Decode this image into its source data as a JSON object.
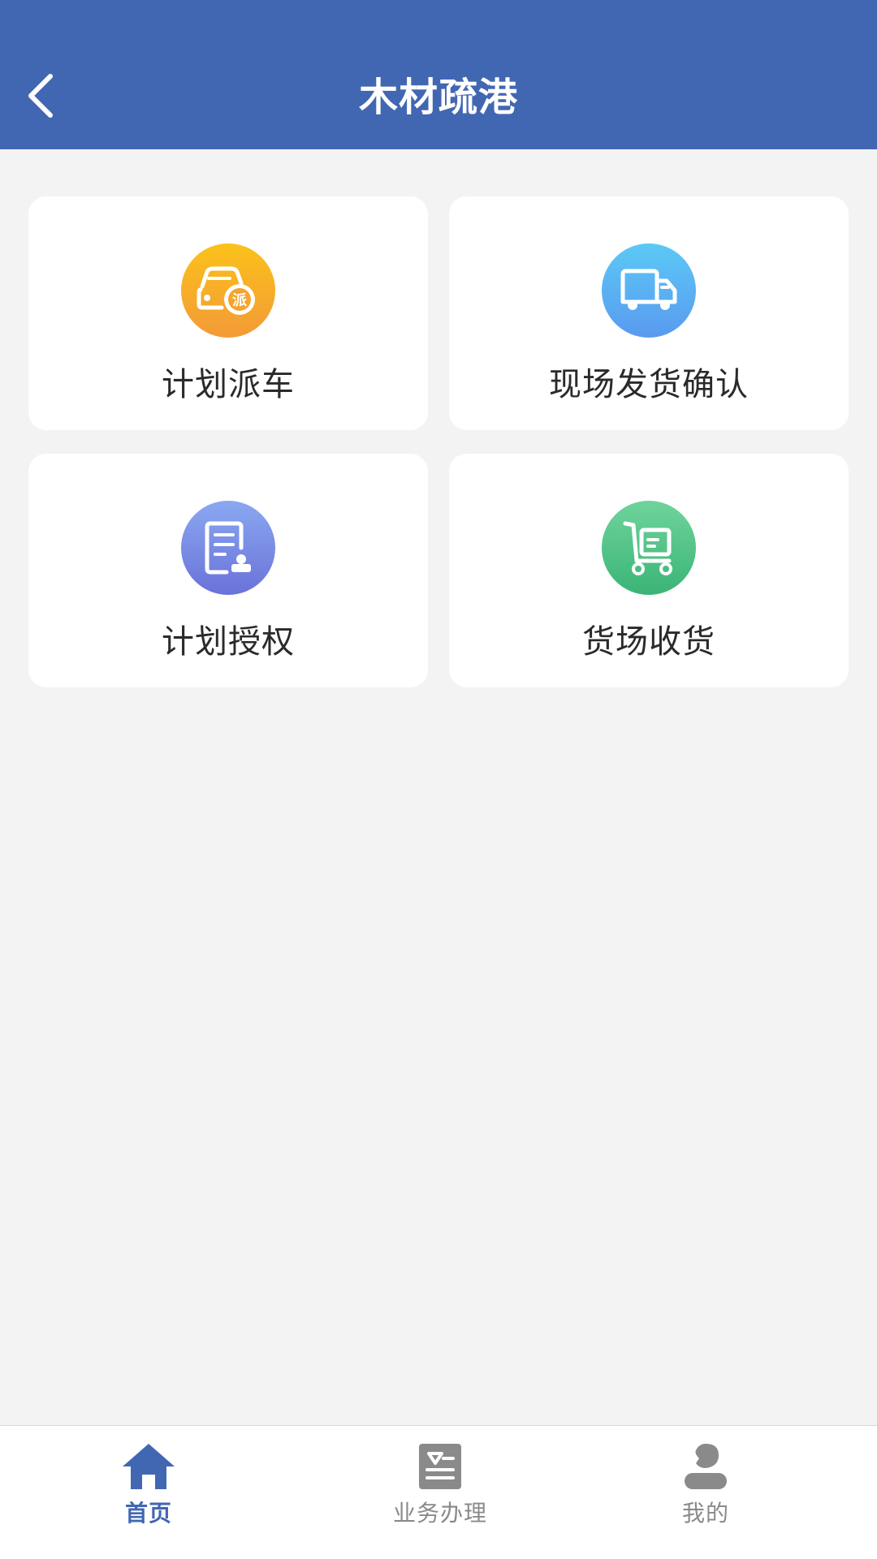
{
  "header": {
    "title": "木材疏港",
    "back_icon": "chevron-left-icon",
    "bg_color": "#4267b2"
  },
  "menu": {
    "items": [
      {
        "label": "计划派车",
        "icon": "car-dispatch-icon",
        "icon_text": "派",
        "color": "#f7ae2a"
      },
      {
        "label": "现场发货确认",
        "icon": "truck-icon",
        "color": "#5ab1f3"
      },
      {
        "label": "计划授权",
        "icon": "document-stamp-icon",
        "color": "#7a8de6"
      },
      {
        "label": "货场收货",
        "icon": "cart-icon",
        "color": "#52c487"
      }
    ]
  },
  "tabbar": {
    "active_color": "#4267b2",
    "inactive_color": "#8a8a8a",
    "tabs": [
      {
        "label": "首页",
        "icon": "home-icon",
        "active": true
      },
      {
        "label": "业务办理",
        "icon": "business-icon",
        "active": false
      },
      {
        "label": "我的",
        "icon": "user-icon",
        "active": false
      }
    ]
  }
}
